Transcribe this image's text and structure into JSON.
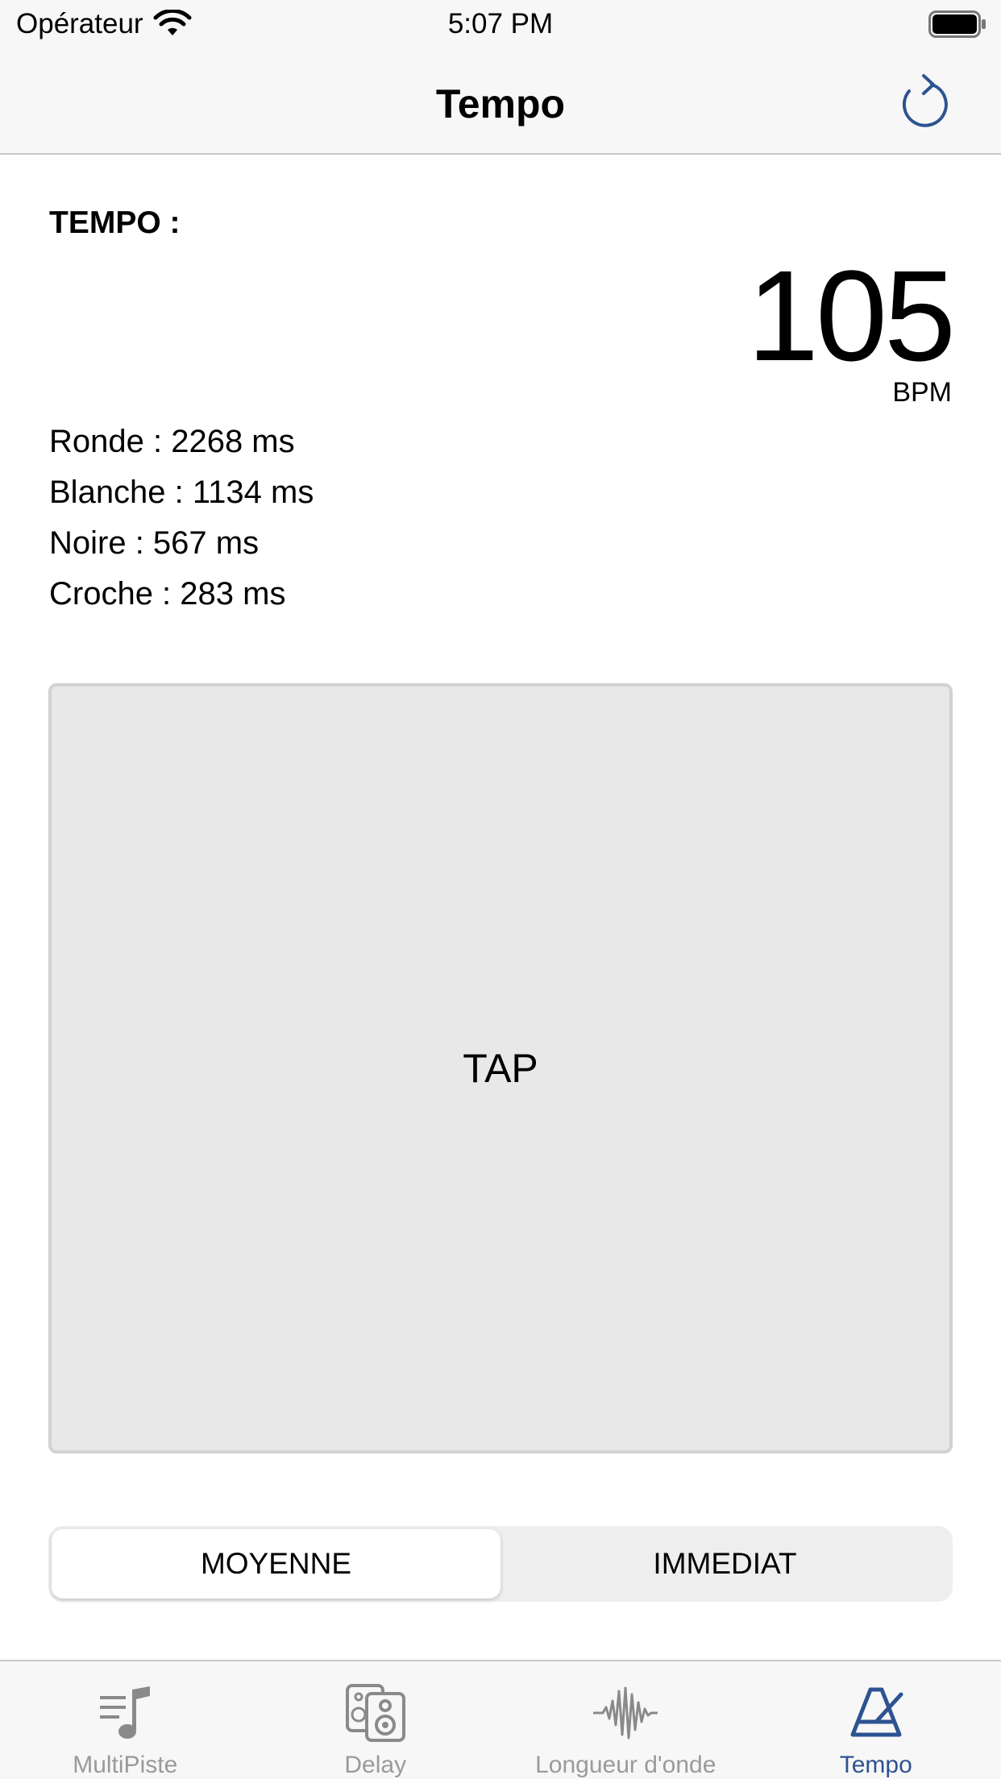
{
  "status_bar": {
    "carrier": "Opérateur",
    "time": "5:07 PM"
  },
  "nav": {
    "title": "Tempo",
    "refresh_icon": "refresh-icon"
  },
  "tempo": {
    "label": "TEMPO :",
    "bpm": "105",
    "unit": "BPM",
    "durations": [
      {
        "text": "Ronde : 2268 ms"
      },
      {
        "text": "Blanche : 1134 ms"
      },
      {
        "text": "Noire : 567 ms"
      },
      {
        "text": "Croche : 283 ms"
      }
    ]
  },
  "tap": {
    "label": "TAP"
  },
  "mode": {
    "options": [
      {
        "label": "MOYENNE",
        "selected": true
      },
      {
        "label": "IMMEDIAT",
        "selected": false
      }
    ]
  },
  "tabs": [
    {
      "label": "MultiPiste",
      "icon": "multitrack-music-icon",
      "active": false
    },
    {
      "label": "Delay",
      "icon": "speaker-icon",
      "active": false
    },
    {
      "label": "Longueur d'onde",
      "icon": "waveform-icon",
      "active": false
    },
    {
      "label": "Tempo",
      "icon": "metronome-icon",
      "active": true
    }
  ],
  "colors": {
    "accent": "#2d5391",
    "inactive": "#9a9a9a",
    "tap_bg": "#e8e8e8"
  }
}
